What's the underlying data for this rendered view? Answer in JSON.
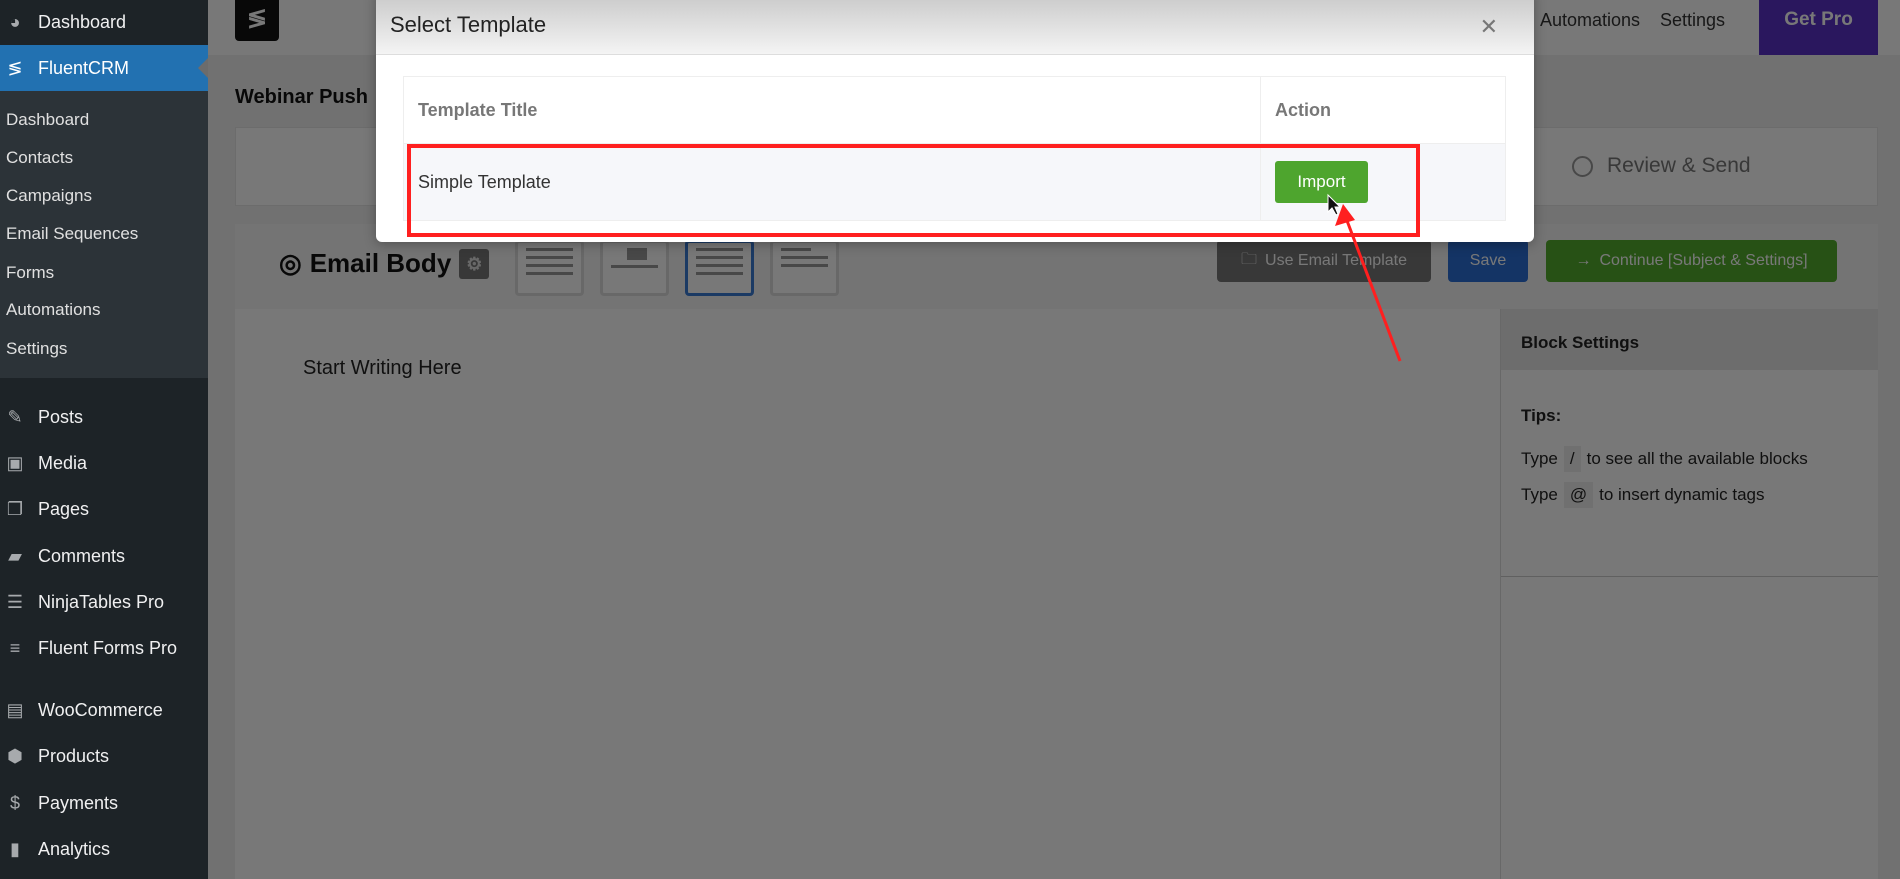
{
  "sidebar": {
    "dashboard": "Dashboard",
    "fluentcrm": "FluentCRM",
    "sub": [
      "Dashboard",
      "Contacts",
      "Campaigns",
      "Email Sequences",
      "Forms",
      "Automations",
      "Settings"
    ],
    "items": [
      "Posts",
      "Media",
      "Pages",
      "Comments",
      "NinjaTables Pro",
      "Fluent Forms Pro",
      "WooCommerce",
      "Products",
      "Payments",
      "Analytics"
    ]
  },
  "topnav": {
    "automations": "Automations",
    "settings": "Settings",
    "get_pro": "Get Pro"
  },
  "campaign_title": "Webinar Push",
  "steps": {
    "review": "Review & Send"
  },
  "email_body": {
    "title": "Email Body",
    "use_template": "Use Email Template",
    "save": "Save",
    "continue": "Continue [Subject & Settings]",
    "placeholder": "Start Writing Here"
  },
  "block_settings": {
    "title": "Block Settings",
    "tips": "Tips:",
    "tip1_pre": "Type",
    "tip1_key": "/",
    "tip1_post": "to see all the available blocks",
    "tip2_pre": "Type",
    "tip2_key": "@",
    "tip2_post": "to insert dynamic tags"
  },
  "modal": {
    "title": "Select Template",
    "col_title": "Template Title",
    "col_action": "Action",
    "rows": [
      {
        "title": "Simple Template",
        "action": "Import"
      }
    ]
  },
  "colors": {
    "accent": "#2271b1",
    "import": "#4ea52e",
    "highlight": "#ff1f1f",
    "get_pro": "#3c1c8c"
  }
}
